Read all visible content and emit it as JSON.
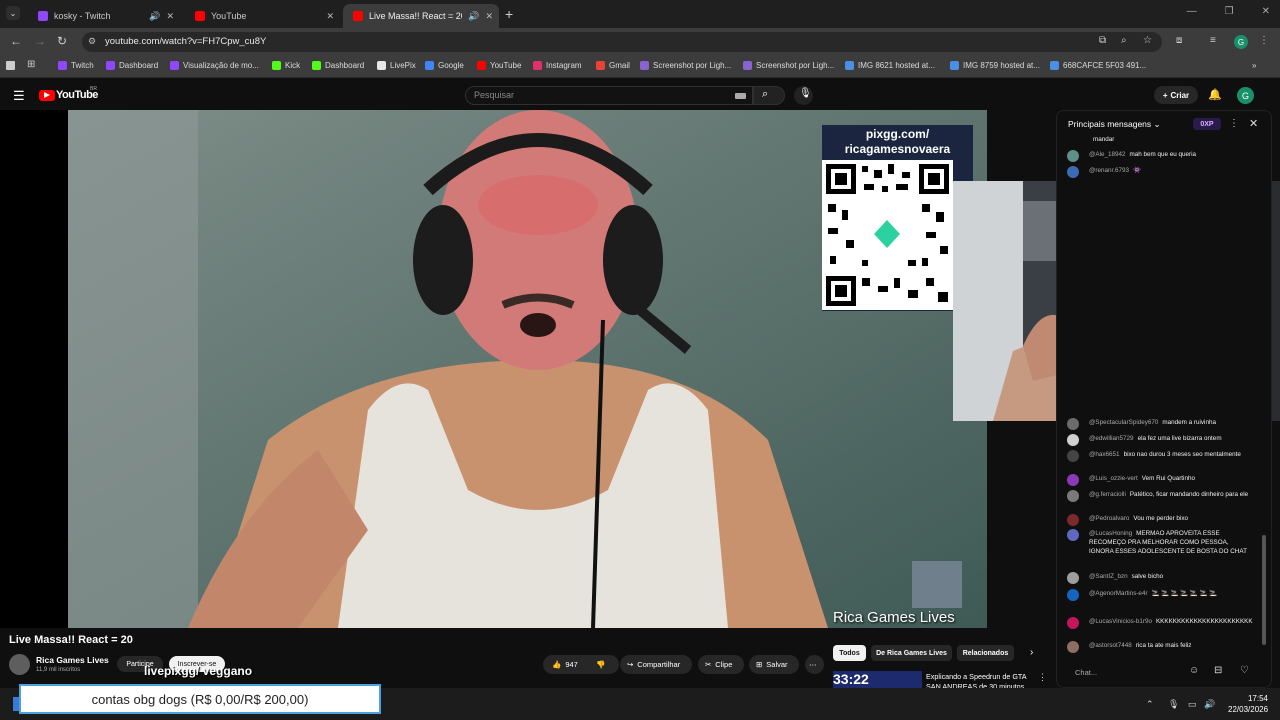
{
  "browser": {
    "tabs": [
      {
        "title": "kosky - Twitch",
        "color": "#9146ff",
        "active": false
      },
      {
        "title": "YouTube",
        "color": "#ff0000",
        "active": false
      },
      {
        "title": "Live Massa!! React = 20 - Yo",
        "color": "#ff0000",
        "active": true
      }
    ],
    "url": "youtube.com/watch?v=FH7Cpw_cu8Y",
    "bookmarks": [
      {
        "label": "Twitch",
        "color": "#9146ff"
      },
      {
        "label": "Dashboard",
        "color": "#9146ff"
      },
      {
        "label": "Visualização de mo...",
        "color": "#9146ff"
      },
      {
        "label": "Kick",
        "color": "#53fc18"
      },
      {
        "label": "Dashboard",
        "color": "#53fc18"
      },
      {
        "label": "LivePix",
        "color": "#e8e8e8"
      },
      {
        "label": "Google",
        "color": "#4285f4"
      },
      {
        "label": "YouTube",
        "color": "#ff0000"
      },
      {
        "label": "Instagram",
        "color": "#e1306c"
      },
      {
        "label": "Gmail",
        "color": "#ea4335"
      },
      {
        "label": "Screenshot por Ligh...",
        "color": "#8a63d2"
      },
      {
        "label": "Screenshot por Ligh...",
        "color": "#8a63d2"
      },
      {
        "label": "IMG 8621 hosted at...",
        "color": "#4a90e2"
      },
      {
        "label": "IMG 8759 hosted at...",
        "color": "#4a90e2"
      },
      {
        "label": "668CAFCE 5F03 491...",
        "color": "#4a90e2"
      }
    ],
    "profile_initial": "G"
  },
  "youtube": {
    "logo_text": "YouTube",
    "country": "BR",
    "search_placeholder": "Pesquisar",
    "create_label": "Criar",
    "avatar_initial": "G"
  },
  "video": {
    "qr_line1": "pixgg.com/",
    "qr_line2": "ricagamesnovaera",
    "channel_overlay": "Rica Games Lives",
    "title": "Live Massa!! React = 20",
    "channel_name": "Rica Games Lives",
    "subscribers": "11,9 mil inscritos",
    "join_label": "Participe",
    "subscribe_label": "Inscrever-se",
    "likes": "947",
    "share_label": "Compartilhar",
    "clip_label": "Clipe",
    "save_label": "Salvar"
  },
  "overlay": {
    "pix_name": "livepixgg/ veggano",
    "pix_banner": "contas obg dogs (R$ 0,00/R$ 200,00)"
  },
  "chips": [
    "Todos",
    "De Rica Games Lives",
    "Relacionados"
  ],
  "recommendation": {
    "duration": "33:22",
    "title": "Explicando a Speedrun de GTA SAN ANDREAS de 30 minutos"
  },
  "chat": {
    "header": "Principais mensagens",
    "xp_badge": "0XP",
    "input_placeholder": "Chat...",
    "messages_top": [
      {
        "author": "",
        "text": "mandar",
        "color": "#0f0f0f"
      },
      {
        "author": "@Ale_18942",
        "text": "mah bem que eu queria",
        "color": "#5f8f86"
      },
      {
        "author": "@renanr.6793",
        "text": "👾",
        "color": "#3d6bb3"
      }
    ],
    "messages": [
      {
        "author": "@SpectacularSpidey670",
        "text": "mandem a ruivinha",
        "color": "#6b6b6b"
      },
      {
        "author": "@edwillian5729",
        "text": "ela fez uma live bizarra ontem",
        "color": "#d0d0d0"
      },
      {
        "author": "@hax6651",
        "text": "bixo nao durou 3 meses seo mentalmente",
        "color": "#444"
      },
      {
        "author": "@Luis_ozzie-vert",
        "text": "Vem Rui Quartinho",
        "color": "#8a3ab9"
      },
      {
        "author": "@g.ferraciolli",
        "text": "Patético, ficar mandando dinheiro para ele",
        "color": "#7a7a7a"
      },
      {
        "author": "@Pedroalvaro",
        "text": "Vou me perder bixo",
        "color": "#7a2a2a"
      },
      {
        "author": "@LucasHoning",
        "text": "MERMAO APROVEITA ESSE RECOMEÇO PRA MELHORAR COMO PESSOA, IGNORA ESSES ADOLESCENTE DE BOSTA DO CHAT",
        "color": "#5c6bc0"
      },
      {
        "author": "@SantIZ_bzn",
        "text": "salve bicho",
        "color": "#9e9e9e"
      },
      {
        "author": "@AgenorMartins-e4r",
        "text": "🚬 🚬 🚬 🚬 🚬 🚬 🚬",
        "color": "#1565c0"
      },
      {
        "author": "@LucasVinicios-b1r9o",
        "text": "KKKKKKKKKKKKKKKKKKKKKKK",
        "color": "#c2185b"
      },
      {
        "author": "@astorsot7448",
        "text": "rica ta ate mais feliz",
        "color": "#8d6e63"
      }
    ]
  },
  "taskbar": {
    "time": "17:54",
    "date": "22/03/2026"
  }
}
